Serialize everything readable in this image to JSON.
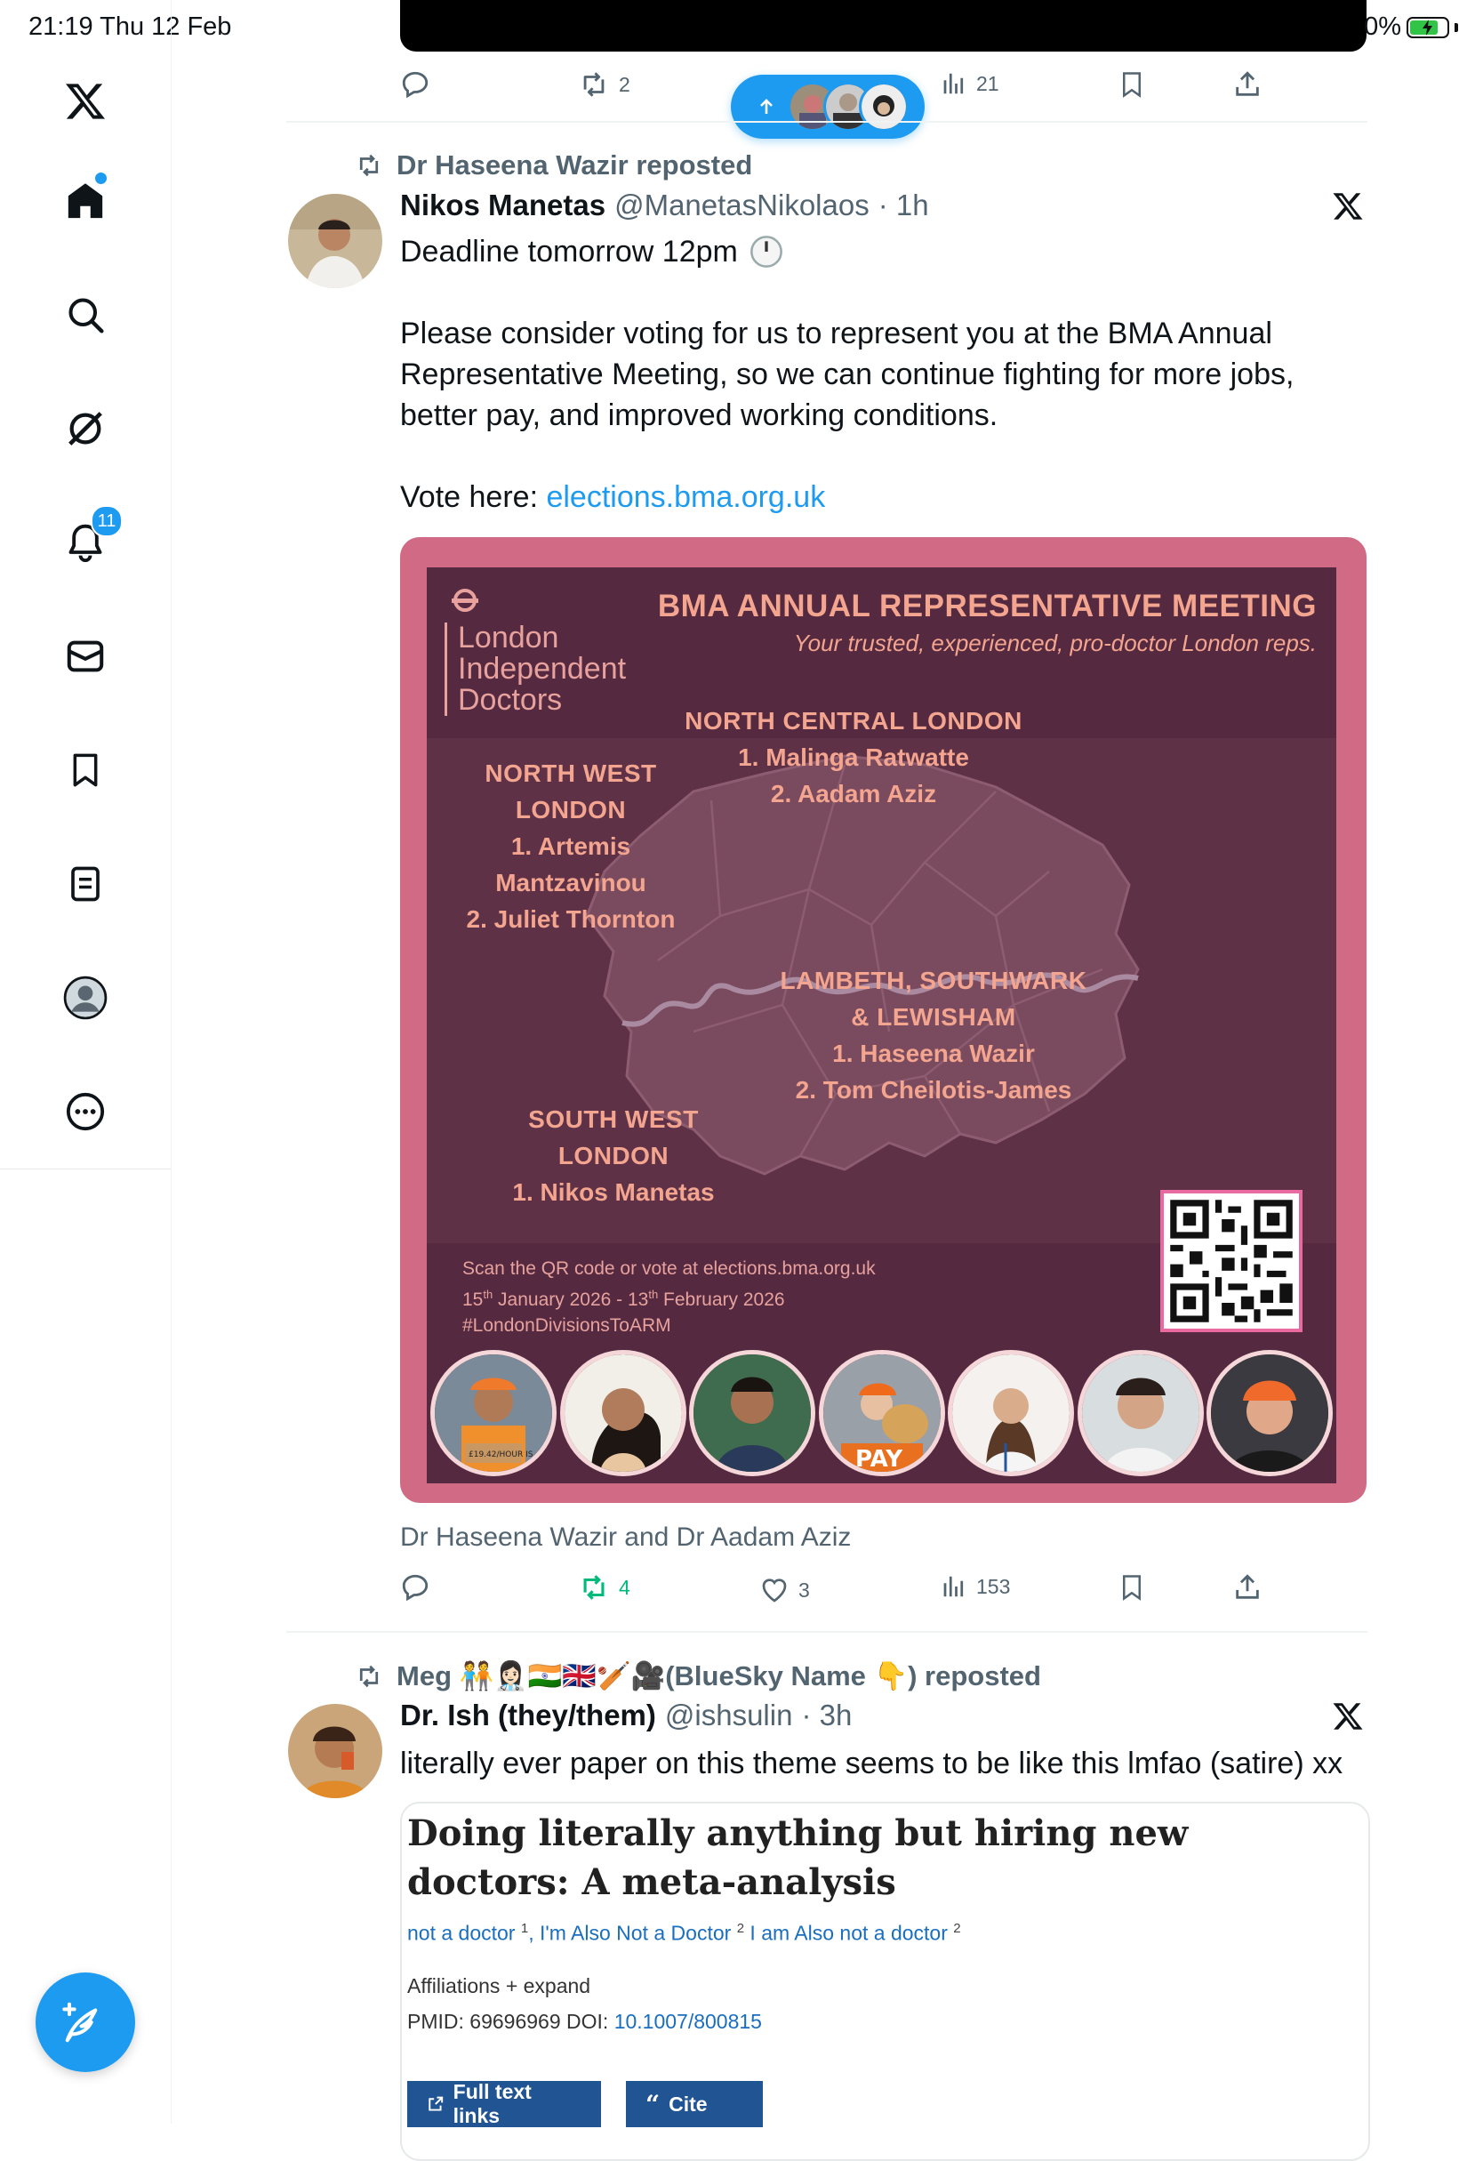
{
  "status_bar": {
    "time_date": "21:19   Thu 12 Feb",
    "battery": "0%"
  },
  "sidebar": {
    "items": [
      {
        "icon": "x-logo-icon"
      },
      {
        "icon": "home-icon"
      },
      {
        "icon": "search-icon"
      },
      {
        "icon": "grok-icon"
      },
      {
        "icon": "bell-icon",
        "badge": "11"
      },
      {
        "icon": "mail-icon"
      },
      {
        "icon": "bookmark-icon"
      },
      {
        "icon": "list-icon"
      },
      {
        "icon": "profile-icon"
      },
      {
        "icon": "more-icon"
      }
    ],
    "compose_icon": "compose-icon"
  },
  "top_tweet_actions": {
    "retweets": "2",
    "views": "21"
  },
  "tweet1": {
    "repost_label": "Dr Haseena Wazir reposted",
    "name": "Nikos Manetas",
    "handle": "@ManetasNikolaos",
    "time": "· 1h",
    "line1": "Deadline tomorrow 12pm",
    "para": "Please consider voting for us to represent you at the BMA Annual Representative Meeting, so we can continue fighting for more jobs, better pay, and improved working conditions.",
    "vote_prefix": "Vote here: ",
    "vote_link": "elections.bma.org.uk",
    "caption": "Dr Haseena Wazir and Dr Aadam Aziz",
    "actions": {
      "retweets": "4",
      "likes": "3",
      "views": "153"
    }
  },
  "poster": {
    "org_line1": "London",
    "org_line2": "Independent",
    "org_line3": "Doctors",
    "title": "BMA ANNUAL REPRESENTATIVE MEETING",
    "subtitle": "Your trusted, experienced, pro-doctor London reps.",
    "ncl": {
      "name": "NORTH CENTRAL LONDON",
      "c1": "1. Malinga Ratwatte",
      "c2": "2. Aadam Aziz"
    },
    "nwl": {
      "name": "NORTH WEST LONDON",
      "c1": "1. Artemis Mantzavinou",
      "c2": "2. Juliet Thornton"
    },
    "lsl": {
      "name1": "LAMBETH, SOUTHWARK",
      "name2": "& LEWISHAM",
      "c1": "1. Haseena Wazir",
      "c2": "2. Tom Cheilotis-James"
    },
    "swl": {
      "name": "SOUTH WEST LONDON",
      "c1": "1. Nikos Manetas"
    },
    "foot1": "Scan the QR code or vote at elections.bma.org.uk",
    "foot2a": "15",
    "foot2b": "th",
    "foot2c": " January 2026 - 13",
    "foot2d": "th",
    "foot2e": " February 2026",
    "foot3": "#LondonDivisionsToARM",
    "sign_text": "£19.42/HOUR IS",
    "pay_text": "PAY"
  },
  "tweet2": {
    "repost_label": "Meg 🧑‍🤝‍🧑👩🏻‍⚕️🇮🇳🇬🇧🏏🎥(BlueSky Name 👇) reposted",
    "name": "Dr. Ish (they/them)",
    "handle": "@ishsulin",
    "time": "· 3h",
    "text": "literally ever paper on this theme seems to be like this lmfao (satire) xx"
  },
  "paper": {
    "title": "Doing literally anything but hiring new doctors: A meta-analysis",
    "author1": "not a doctor",
    "sup1": "1",
    "author2": "I'm Also Not a Doctor",
    "sup2": "2",
    "author3": "I am Also not a doctor",
    "sup3": "2",
    "affiliations": "Affiliations",
    "expand": "+ expand",
    "pmid": "PMID: 69696969",
    "doi_label": "DOI: ",
    "doi": "10.1007/800815",
    "btn_fulltext": "Full text links",
    "btn_cite": "Cite"
  }
}
